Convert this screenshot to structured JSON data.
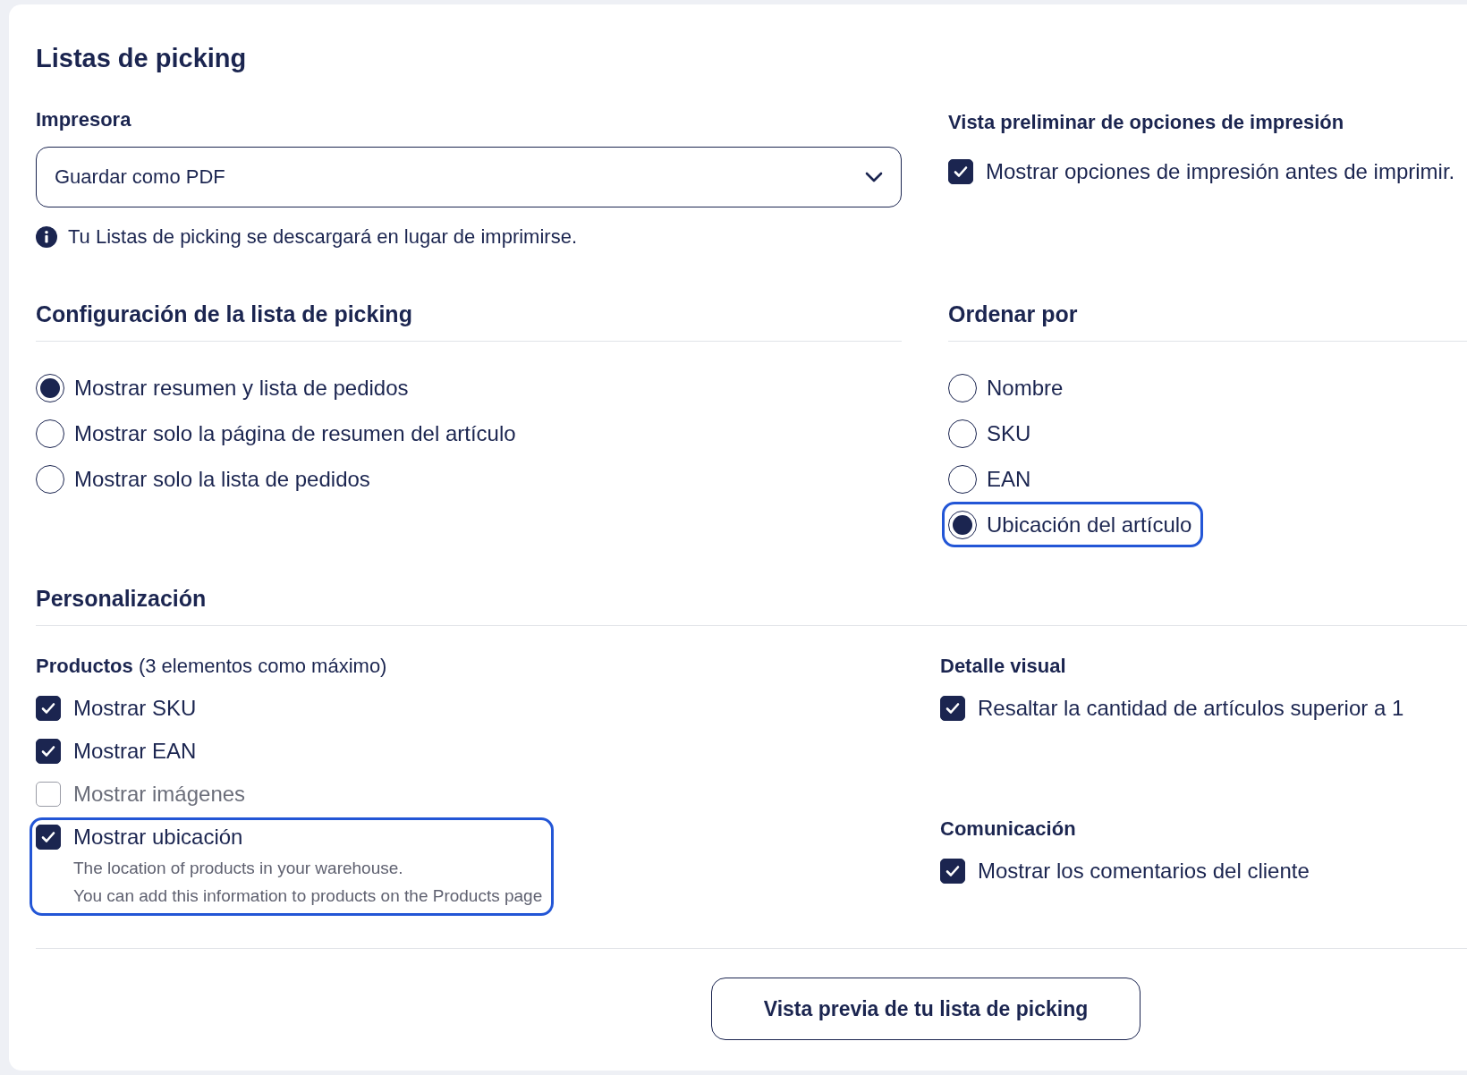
{
  "title": "Listas de picking",
  "printer": {
    "label": "Impresora",
    "value": "Guardar como PDF",
    "info": "Tu Listas de picking se descargará en lugar de imprimirse."
  },
  "preview_options": {
    "heading": "Vista preliminar de opciones de impresión",
    "items": [
      {
        "label": "Mostrar opciones de impresión antes de imprimir.",
        "checked": true,
        "disabled": false,
        "focused": false
      }
    ]
  },
  "config": {
    "heading": "Configuración de la lista de picking",
    "options": [
      {
        "label": "Mostrar resumen y lista de pedidos",
        "selected": true,
        "focused": false
      },
      {
        "label": "Mostrar solo la página de resumen del artículo",
        "selected": false,
        "focused": false
      },
      {
        "label": "Mostrar solo la lista de pedidos",
        "selected": false,
        "focused": false
      }
    ]
  },
  "sort": {
    "heading": "Ordenar por",
    "options": [
      {
        "label": "Nombre",
        "selected": false,
        "focused": false
      },
      {
        "label": "SKU",
        "selected": false,
        "focused": false
      },
      {
        "label": "EAN",
        "selected": false,
        "focused": false
      },
      {
        "label": "Ubicación del artículo",
        "selected": true,
        "focused": true
      }
    ]
  },
  "personalization": {
    "heading": "Personalización",
    "products": {
      "heading": "**Productos** (3 elementos como máximo)",
      "items": [
        {
          "label": "Mostrar SKU",
          "checked": true,
          "disabled": false,
          "focused": false
        },
        {
          "label": "Mostrar EAN",
          "checked": true,
          "disabled": false,
          "focused": false
        },
        {
          "label": "Mostrar imágenes",
          "checked": false,
          "disabled": true,
          "focused": false
        },
        {
          "label": "Mostrar ubicación",
          "checked": true,
          "disabled": false,
          "focused": true,
          "help": [
            "The location of products in your warehouse.",
            "You can add this information to products on the Products page"
          ]
        }
      ]
    },
    "visual_detail": {
      "heading": "Detalle visual",
      "items": [
        {
          "label": "Resaltar la cantidad de artículos superior a 1",
          "checked": true,
          "disabled": false,
          "focused": false
        }
      ]
    },
    "communication": {
      "heading": "Comunicación",
      "items": [
        {
          "label": "Mostrar los comentarios del cliente",
          "checked": true,
          "disabled": false,
          "focused": false
        }
      ]
    }
  },
  "preview_button": "Vista previa de tu lista de picking"
}
